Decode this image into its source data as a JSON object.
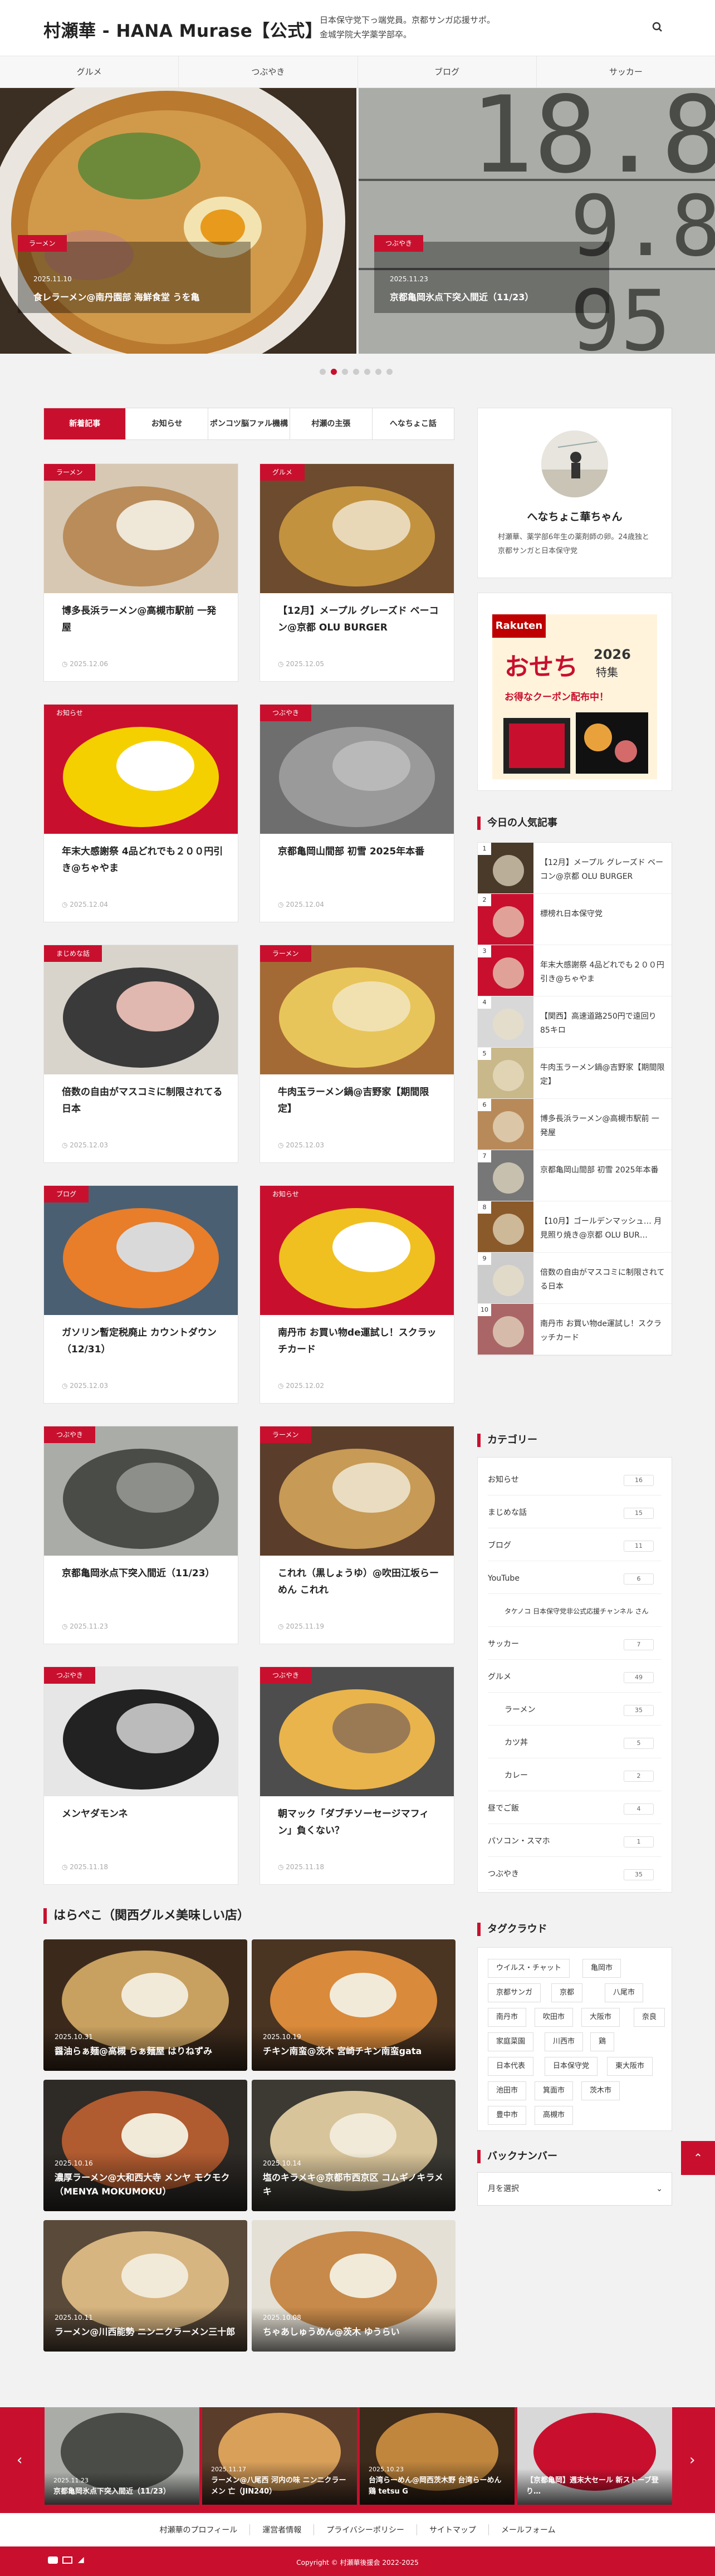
{
  "header": {
    "site_title": "村瀬華 - HANA Murase【公式】",
    "tagline": "日本保守党下っ端党員。京都サンガ応援サポ。金城学院大学薬学部卒。"
  },
  "nav": [
    "グルメ",
    "つぶやき",
    "ブログ",
    "サッカー"
  ],
  "slider": [
    {
      "category": "ラーメン",
      "date": "2025.11.10",
      "title": "食レラーメン@南丹園部 海鮮食堂 うを亀"
    },
    {
      "category": "つぶやき",
      "date": "2025.11.23",
      "title": "京都亀岡氷点下突入間近（11/23）"
    }
  ],
  "tabs": [
    "新着記事",
    "お知らせ",
    "ポンコツ脳ファル機構",
    "村瀬の主張",
    "へなちょこ話"
  ],
  "articles": [
    {
      "category": "ラーメン",
      "title": "博多長浜ラーメン@高槻市駅前 一発屋",
      "date": "2025.12.06"
    },
    {
      "category": "グルメ",
      "title": "【12月】メープル グレーズド ベーコン@京都 OLU BURGER",
      "date": "2025.12.05"
    },
    {
      "category": "お知らせ",
      "title": "年末大感謝祭 4品どれでも２００円引き@ちゃやま",
      "date": "2025.12.04"
    },
    {
      "category": "つぶやき",
      "title": "京都亀岡山間部 初雪 2025年本番",
      "date": "2025.12.04"
    },
    {
      "category": "まじめな話",
      "title": "倍数の自由がマスコミに制限されてる日本",
      "date": "2025.12.03"
    },
    {
      "category": "ラーメン",
      "title": "牛肉玉ラーメン鍋@吉野家【期間限定】",
      "date": "2025.12.03"
    },
    {
      "category": "ブログ",
      "title": "ガソリン暫定税廃止 カウントダウン（12/31）",
      "date": "2025.12.03"
    },
    {
      "category": "お知らせ",
      "title": "南丹市 お買い物de運試し！スクラッチカード",
      "date": "2025.12.02"
    },
    {
      "category": "つぶやき",
      "title": "京都亀岡氷点下突入間近（11/23）",
      "date": "2025.11.23"
    },
    {
      "category": "ラーメン",
      "title": "これれ（黒しょうゆ）@吹田江坂らーめん これれ",
      "date": "2025.11.19"
    },
    {
      "category": "つぶやき",
      "title": "メンヤダモンネ",
      "date": "2025.11.18"
    },
    {
      "category": "つぶやき",
      "title": "朝マック「ダブチソーセージマフィン」負くない？",
      "date": "2025.11.18"
    }
  ],
  "harapeko": {
    "heading": "はらぺこ（関西グルメ美味しい店）",
    "items": [
      {
        "date": "2025.10.31",
        "title": "醤油らぁ麺@高槻 らぁ麺屋 はりねずみ"
      },
      {
        "date": "2025.10.19",
        "title": "チキン南蛮@茨木 宮崎チキン南蛮gata"
      },
      {
        "date": "2025.10.16",
        "title": "濃厚ラーメン@大和西大寺 メンヤ モクモク（MENYA MOKUMOKU）"
      },
      {
        "date": "2025.10.14",
        "title": "塩のキラメキ@京都市西京区 コムギノキラメキ"
      },
      {
        "date": "2025.10.11",
        "title": "ラーメン@川西能勢 ニンニクラーメン三十郎"
      },
      {
        "date": "2025.10.08",
        "title": "ちゃあしゅうめん@茨木 ゆうらい"
      }
    ]
  },
  "profile": {
    "name": "へなちょこ華ちゃん",
    "bio": "村瀬華、薬学部6年生の薬剤師の卵。24歳独と京都サンガと日本保守党"
  },
  "ad": {
    "brand": "Rakuten",
    "title": "おせち",
    "year": "2026",
    "sub": "特集",
    "coupon": "お得なクーポン配布中！"
  },
  "popular": {
    "heading": "今日の人気記事",
    "items": [
      "【12月】メープル グレーズド ベーコン@京都 OLU BURGER",
      "標榜れ日本保守党",
      "年末大感謝祭 4品どれでも２００円引き@ちゃやま",
      "【関西】高速道路250円で遠回り85キロ",
      "牛肉玉ラーメン鍋@吉野家【期間限定】",
      "博多長浜ラーメン@高槻市駅前 一発屋",
      "京都亀岡山間部 初雪 2025年本番",
      "【10月】ゴールデンマッシュ… 月見照り焼き@京都 OLU BUR…",
      "倍数の自由がマスコミに制限されてる日本",
      "南丹市 お買い物de運試し！スクラッチカード"
    ]
  },
  "categories": {
    "heading": "カテゴリー",
    "items": [
      {
        "name": "お知らせ",
        "count": "16",
        "indent": false
      },
      {
        "name": "まじめな話",
        "count": "15",
        "indent": false
      },
      {
        "name": "ブログ",
        "count": "11",
        "indent": false
      },
      {
        "name": "YouTube",
        "count": "6",
        "indent": false
      },
      {
        "name": "タケノコ 日本保守党非公式応援チャンネル さん",
        "count": "",
        "indent": true
      },
      {
        "name": "サッカー",
        "count": "7",
        "indent": false
      },
      {
        "name": "グルメ",
        "count": "49",
        "indent": false
      },
      {
        "name": "ラーメン",
        "count": "35",
        "indent": true
      },
      {
        "name": "カツ丼",
        "count": "5",
        "indent": true
      },
      {
        "name": "カレー",
        "count": "2",
        "indent": true
      },
      {
        "name": "昼でご飯",
        "count": "4",
        "indent": false
      },
      {
        "name": "パソコン・スマホ",
        "count": "1",
        "indent": false
      },
      {
        "name": "つぶやき",
        "count": "35",
        "indent": false
      }
    ]
  },
  "tags": {
    "heading": "タグクラウド",
    "items": [
      "ウイルス・チャット",
      "亀岡市",
      "京都サンガ",
      "京都",
      "八尾市",
      "南丹市",
      "吹田市",
      "大阪市",
      "奈良",
      "家庭菜園",
      "川西市",
      "鶏",
      "日本代表",
      "日本保守党",
      "東大阪市",
      "池田市",
      "箕面市",
      "茨木市",
      "豊中市",
      "高槻市"
    ]
  },
  "backnumber": {
    "heading": "バックナンバー",
    "placeholder": "月を選択"
  },
  "footer_slider": [
    {
      "date": "2025.11.23",
      "title": "京都亀岡氷点下突入間近（11/23）"
    },
    {
      "date": "2025.11.17",
      "title": "ラーメン@八尾西 河内の味 ニンニクラーメン 亡（JIN240）"
    },
    {
      "date": "2025.10.23",
      "title": "台湾らーめん@岡西茨木野 台湾らーめん 鶏 tetsu G"
    },
    {
      "date": "",
      "title": "【京都亀岡】週末大セール 新ストーブ登り…"
    }
  ],
  "footer_links": [
    "村瀬華のプロフィール",
    "運営者情報",
    "プライバシーポリシー",
    "サイトマップ",
    "メールフォーム"
  ],
  "copyright": "Copyright © 村瀬華後援会 2022-2025",
  "colors": {
    "accent": "#c8102e",
    "background": "#f2f2f2"
  }
}
